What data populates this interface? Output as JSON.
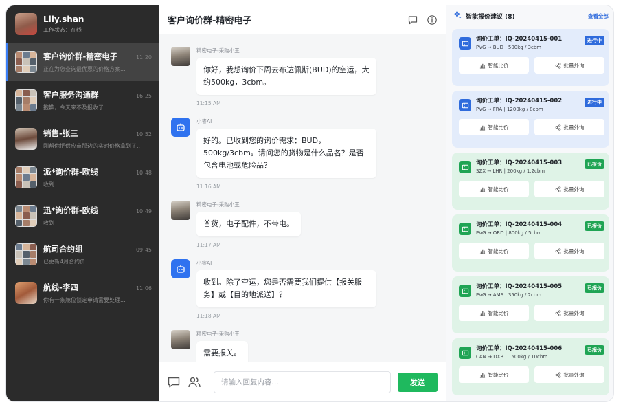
{
  "profile": {
    "name": "Lily.shan",
    "status": "工作状态：在线"
  },
  "conversations": [
    {
      "name": "客户询价群-精密电子",
      "time": "11:20",
      "preview": "正在为您查询最优惠的价格方案...",
      "active": true
    },
    {
      "name": "客户服务沟通群",
      "time": "16:25",
      "preview": "抱歉，今天来不及报收了..."
    },
    {
      "name": "销售-张三",
      "time": "10:52",
      "preview": "刚帮你把供应商那边的实时价格拿到了..."
    },
    {
      "name": "派*询价群-欧线",
      "time": "10:48",
      "preview": "收到"
    },
    {
      "name": "迅*询价群-欧线",
      "time": "10:49",
      "preview": "收到"
    },
    {
      "name": "航司合约组",
      "time": "09:45",
      "preview": "已更新4月合约价"
    },
    {
      "name": "航线-李四",
      "time": "11:06",
      "preview": "你有一条舱位锁定申请需要处理..."
    }
  ],
  "chat": {
    "title": "客户询价群-精密电子",
    "messages": [
      {
        "sender": "精密电子-采购小王",
        "text": "你好，我想询价下周去布达佩斯(BUD)的空运，大约500kg，3cbm。",
        "time": "11:15 AM",
        "type": "customer"
      },
      {
        "sender": "小睿AI",
        "text": "好的。已收到您的询价需求：BUD，500kg/3cbm。请问您的货物是什么品名？是否包含电池或危险品？",
        "time": "11:16 AM",
        "type": "ai"
      },
      {
        "sender": "精密电子-采购小王",
        "text": "普货，电子配件，不带电。",
        "time": "11:17 AM",
        "type": "customer"
      },
      {
        "sender": "小睿AI",
        "text": "收到。除了空运，您是否需要我们提供【报关服务】或【目的地派送】？",
        "time": "11:18 AM",
        "type": "ai"
      },
      {
        "sender": "精密电子-采购小王",
        "text": "需要报关。",
        "time": "",
        "type": "customer"
      }
    ],
    "input_placeholder": "请输入回复内容...",
    "send_label": "发送"
  },
  "panel": {
    "title": "智能报价建议 (8)",
    "view_all": "查看全部",
    "cards": [
      {
        "id": "询价工单：IQ-20240415-001",
        "route": "PVG → BUD | 500kg / 3cbm",
        "status": "进行中",
        "tone": "blue"
      },
      {
        "id": "询价工单：IQ-20240415-002",
        "route": "PVG → FRA | 1200kg / 8cbm",
        "status": "进行中",
        "tone": "blue"
      },
      {
        "id": "询价工单：IQ-20240415-003",
        "route": "SZX → LHR | 200kg / 1.2cbm",
        "status": "已报价",
        "tone": "green"
      },
      {
        "id": "询价工单：IQ-20240415-004",
        "route": "PVG → ORD | 800kg / 5cbm",
        "status": "已报价",
        "tone": "green"
      },
      {
        "id": "询价工单：IQ-20240415-005",
        "route": "PVG → AMS | 350kg / 2cbm",
        "status": "已报价",
        "tone": "green"
      },
      {
        "id": "询价工单：IQ-20240415-006",
        "route": "CAN → DXB | 1500kg / 10cbm",
        "status": "已报价",
        "tone": "green"
      }
    ],
    "compare_label": "智能比价",
    "inquiry_label": "批量外询"
  },
  "colors": {
    "accent_blue": "#2f6bdc",
    "accent_green": "#1fa454",
    "send_green": "#1fb95e",
    "sidebar_bg": "#2b2b2b"
  },
  "icons": [
    "chat-bubble-icon",
    "info-icon",
    "sparkle-icon",
    "ticket-icon",
    "bar-chart-icon",
    "share-icon",
    "robot-icon",
    "people-icon"
  ]
}
